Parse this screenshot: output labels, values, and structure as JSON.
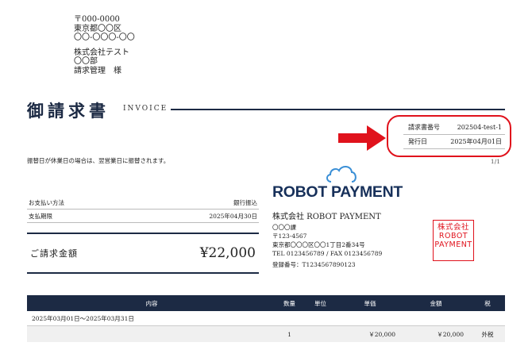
{
  "recipient": {
    "postal": "〒000-0000",
    "pref": "東京都〇〇区",
    "street": "〇〇-〇〇〇-〇〇",
    "company": "株式会社テスト",
    "dept": "〇〇部",
    "contact": "請求管理　様"
  },
  "header": {
    "title": "御請求書",
    "invoice_label": "INVOICE"
  },
  "meta": {
    "number_label": "請求書番号",
    "number_value": "202504-test-1",
    "date_label": "発行日",
    "date_value": "2025年04月01日"
  },
  "note": "振替日が休業日の場合は、翌営業日に振替されます。",
  "page_number": "1/1",
  "payment": {
    "method_label": "お支払い方法",
    "method_value": "銀行振込",
    "due_label": "支払期限",
    "due_value": "2025年04月30日",
    "total_label": "ご請求金額",
    "total_value": "¥22,000"
  },
  "issuer": {
    "logo_text": "ROBOT PAYMENT",
    "name": "株式会社 ROBOT PAYMENT",
    "dept": "〇〇〇課",
    "postal": "〒123-4567",
    "address": "東京都〇〇〇区〇〇1丁目2番34号",
    "tel_fax": "TEL 0123456789 / FAX 0123456789",
    "reg_no": "登録番号：T1234567890123",
    "seal_lines": [
      "株式会社",
      "ROBOT",
      "PAYMENT"
    ]
  },
  "items_table": {
    "headers": [
      "内容",
      "数量",
      "単位",
      "単価",
      "金額",
      "税"
    ],
    "period": "2025年03月01日～2025年03月31日",
    "rows": [
      {
        "desc": "",
        "qty": "1",
        "unit": "",
        "price": "￥20,000",
        "amount": "￥20,000",
        "tax": "外税"
      }
    ]
  },
  "colors": {
    "navy": "#1c2a44",
    "highlight_red": "#e0121c"
  }
}
